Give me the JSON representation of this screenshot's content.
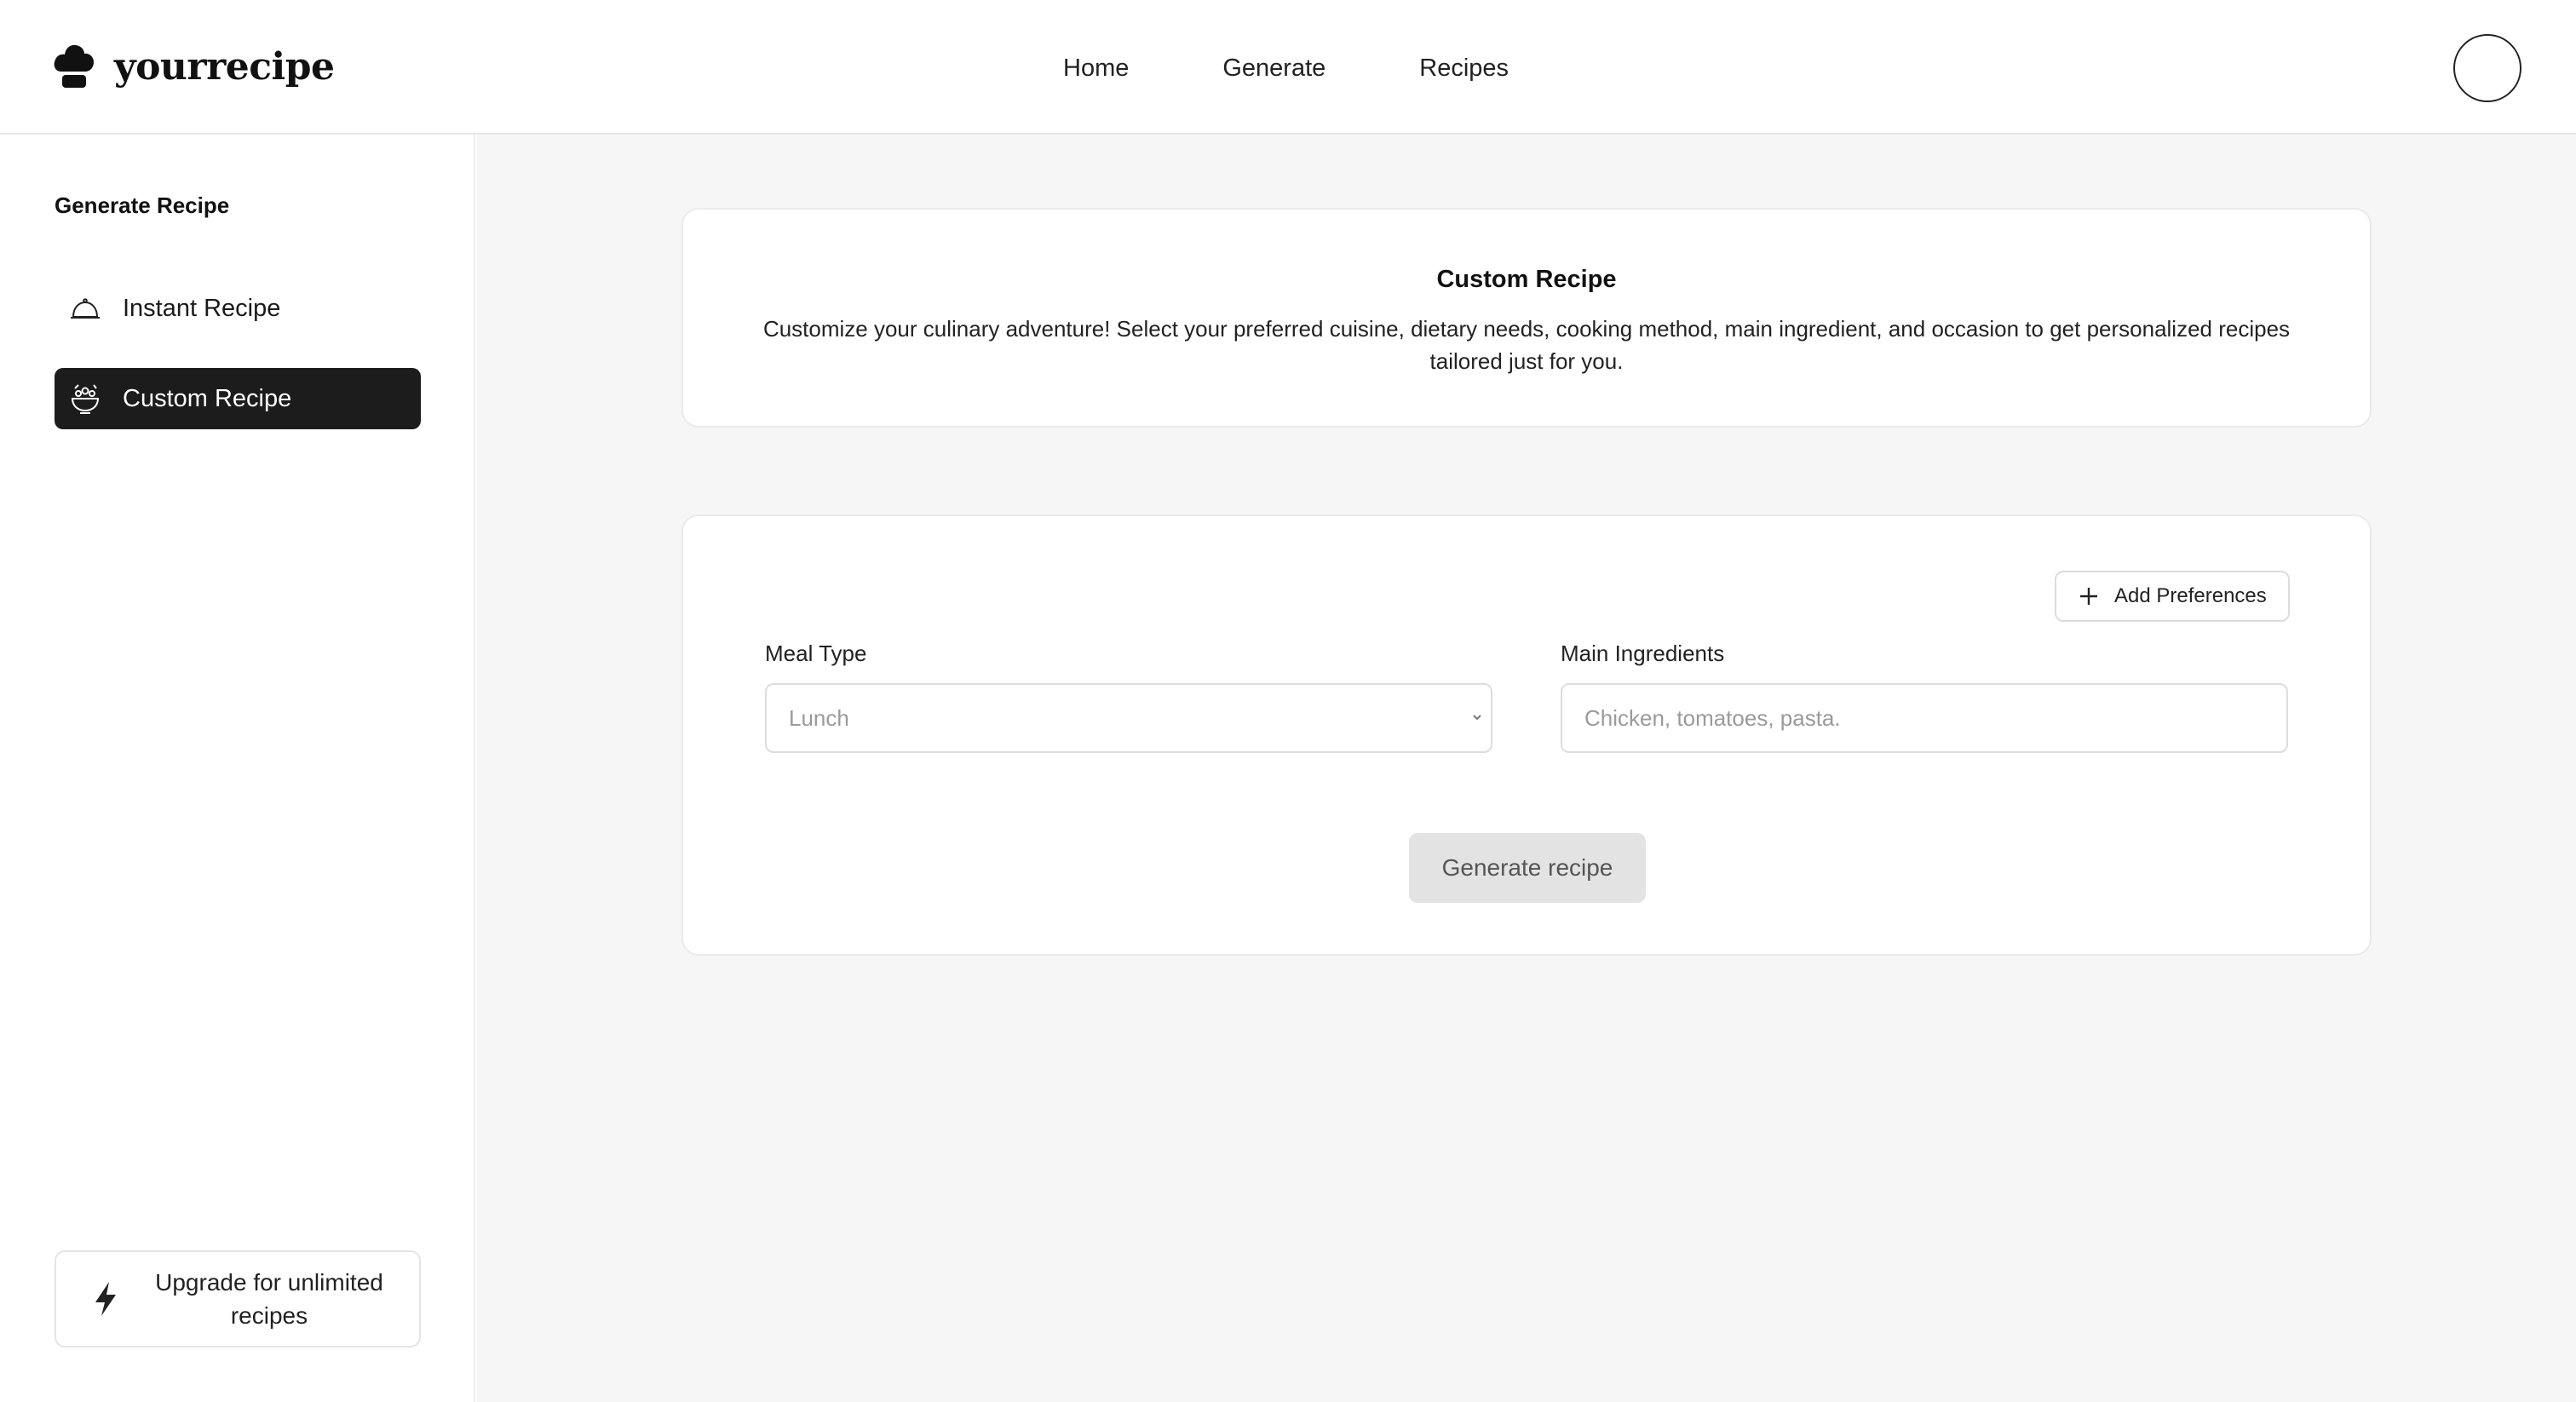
{
  "app": {
    "name": "yourrecipe",
    "logo_icon": "chef-hat-icon"
  },
  "nav": {
    "items": [
      {
        "label": "Home"
      },
      {
        "label": "Generate"
      },
      {
        "label": "Recipes"
      }
    ]
  },
  "sidebar": {
    "title": "Generate Recipe",
    "items": [
      {
        "label": "Instant Recipe",
        "icon": "cloche-icon",
        "active": false
      },
      {
        "label": "Custom Recipe",
        "icon": "bowl-icon",
        "active": true
      }
    ],
    "upgrade": {
      "label": "Upgrade for unlimited recipes",
      "icon": "lightning-icon"
    }
  },
  "intro": {
    "title": "Custom Recipe",
    "description": "Customize your culinary adventure! Select your preferred cuisine, dietary needs, cooking method, main ingredient, and occasion to get personalized recipes tailored just for you."
  },
  "form": {
    "add_preferences_label": "Add Preferences",
    "meal_type": {
      "label": "Meal Type",
      "value": "Lunch"
    },
    "main_ingredients": {
      "label": "Main Ingredients",
      "placeholder": "Chicken, tomatoes, pasta."
    },
    "generate_label": "Generate recipe"
  },
  "colors": {
    "active_bg": "#1c1c1c",
    "main_bg": "#f6f6f6",
    "button_disabled_bg": "#e3e3e3"
  }
}
